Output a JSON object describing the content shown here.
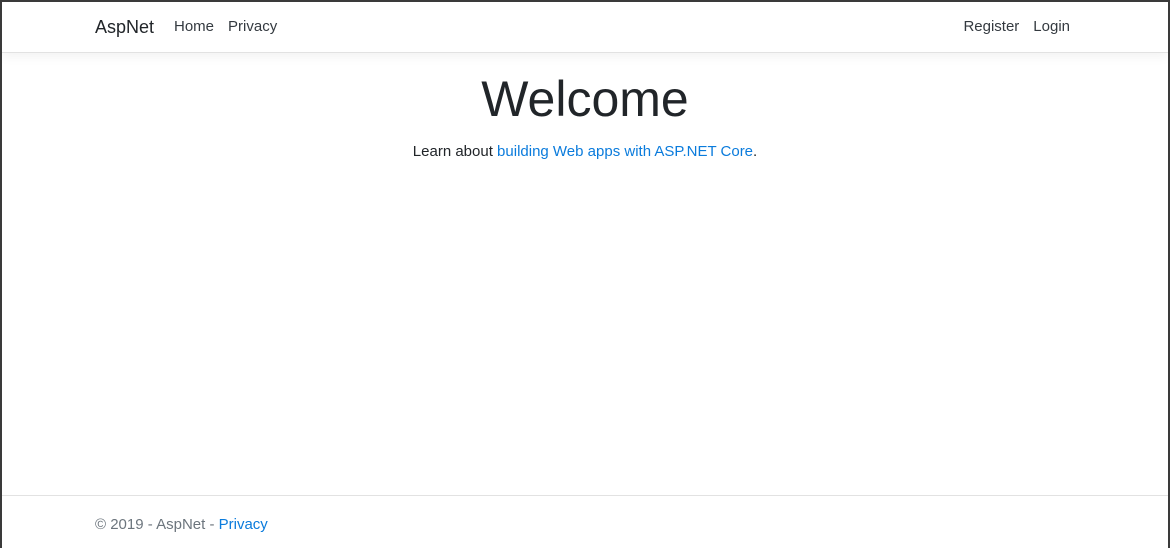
{
  "navbar": {
    "brand": "AspNet",
    "links_left": [
      "Home",
      "Privacy"
    ],
    "links_right": [
      "Register",
      "Login"
    ]
  },
  "main": {
    "title": "Welcome",
    "lead_prefix": "Learn about ",
    "lead_link": "building Web apps with ASP.NET Core",
    "lead_suffix": "."
  },
  "footer": {
    "copyright": "© 2019 - AspNet - ",
    "privacy_link": "Privacy"
  },
  "colors": {
    "link": "#0a7bdc",
    "text": "#212529",
    "muted": "#6c757d",
    "border": "#e2e2e2"
  }
}
